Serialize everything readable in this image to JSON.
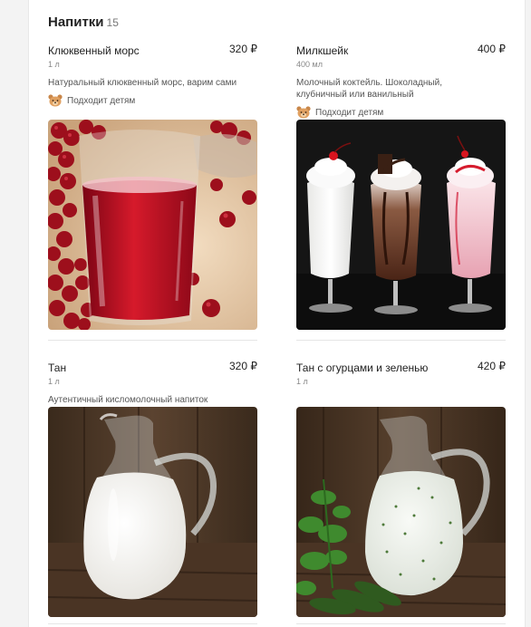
{
  "section": {
    "title": "Напитки",
    "count": "15"
  },
  "items": [
    {
      "name": "Клюквенный морс",
      "price": "320 ₽",
      "weight": "1 л",
      "description": "Натуральный клюквенный морс, варим сами",
      "badge": "Подходит детям",
      "badge_icon": "bear-icon",
      "image": "cranberry-juice-glass"
    },
    {
      "name": "Милкшейк",
      "price": "400 ₽",
      "weight": "400 мл",
      "description_line1": "Молочный коктейль. Шоколадный,",
      "description_line2": "клубничный или ванильный",
      "badge": "Подходит детям",
      "badge_icon": "bear-icon",
      "image": "milkshakes-three-glasses"
    },
    {
      "name": "Тан",
      "price": "320 ₽",
      "weight": "1 л",
      "description": "Аутентичный кисломолочный напиток",
      "image": "tan-jug"
    },
    {
      "name": "Тан с огурцами и зеленью",
      "price": "420 ₽",
      "weight": "1 л",
      "image": "tan-with-cucumbers-jug"
    }
  ],
  "colors": {
    "accent_bear": "#d99a55",
    "separator": "#e6e6e6"
  }
}
